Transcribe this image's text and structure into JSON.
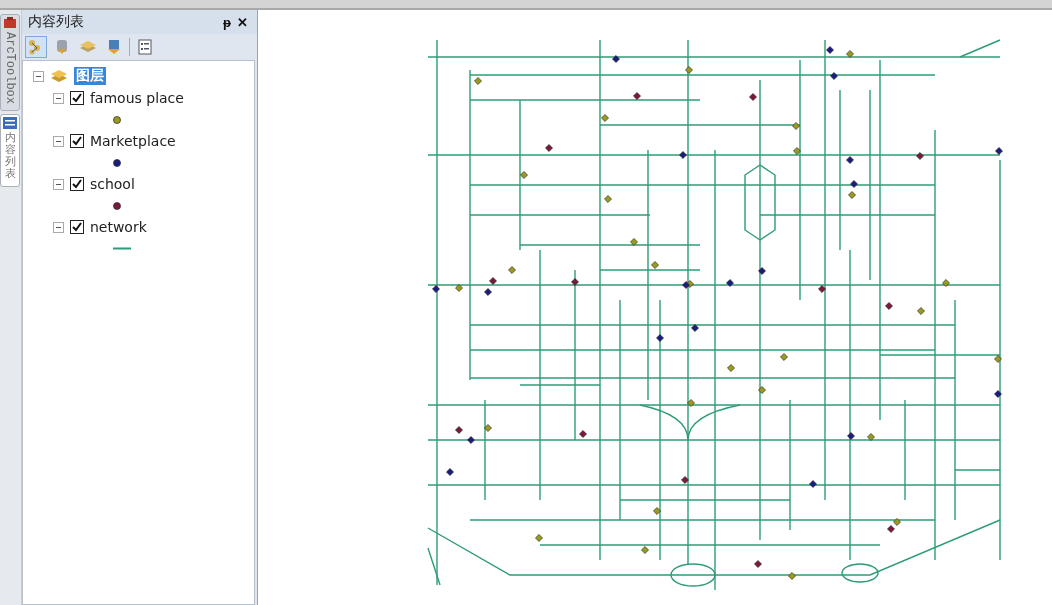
{
  "side_tabs": [
    {
      "kind": "latin",
      "label": "ArcToolbox",
      "selected": false
    },
    {
      "kind": "cjk",
      "label": "内容列表",
      "selected": true
    }
  ],
  "panel": {
    "title": "内容列表",
    "pin": "ᵽ",
    "close": "✕"
  },
  "toc": {
    "root": {
      "label": "图层",
      "selected": true,
      "expanded": true,
      "children": [
        {
          "label": "famous place",
          "checked": true,
          "expanded": true,
          "kind": "point",
          "color": "#9c9a1c"
        },
        {
          "label": "Marketplace",
          "checked": true,
          "expanded": true,
          "kind": "point",
          "color": "#1c1c80"
        },
        {
          "label": "school",
          "checked": true,
          "expanded": true,
          "kind": "point",
          "color": "#7a1840"
        },
        {
          "label": "network",
          "checked": true,
          "expanded": true,
          "kind": "line",
          "color": "#2e9c74"
        }
      ]
    }
  }
}
